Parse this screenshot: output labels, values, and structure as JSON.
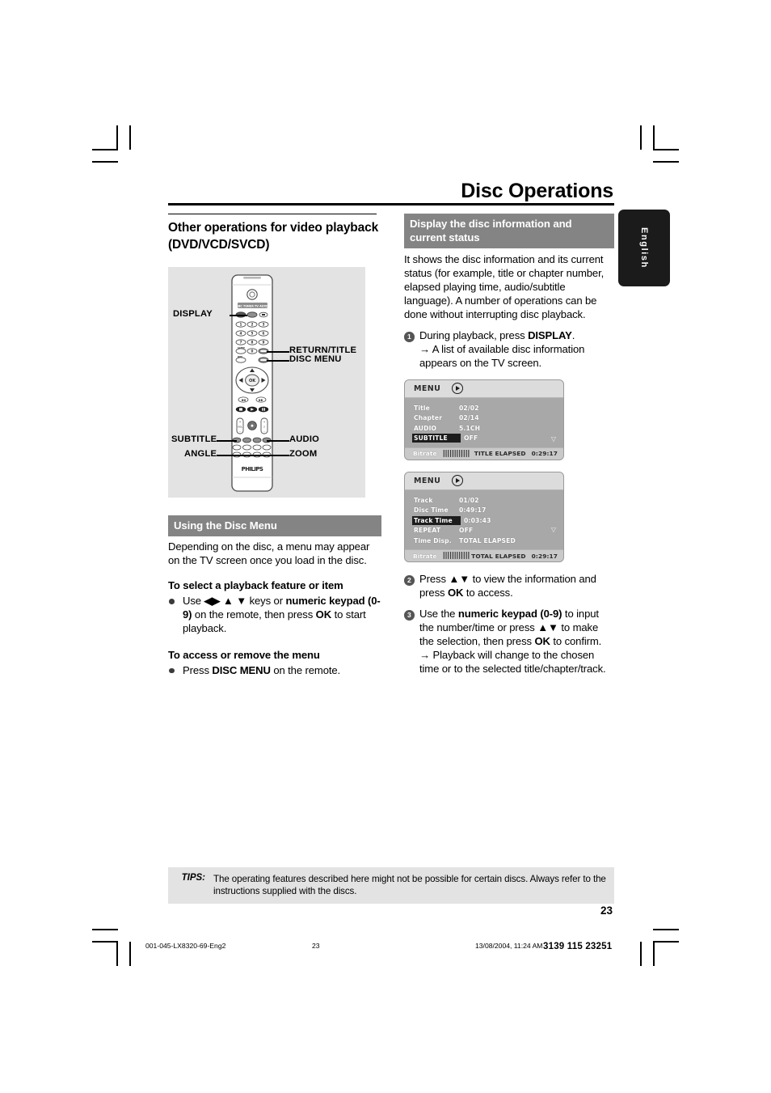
{
  "header": {
    "title": "Disc Operations",
    "language_tab": "English"
  },
  "left_column": {
    "heading": "Other operations for video playback (DVD/VCD/SVCD)",
    "remote_figure": {
      "callouts": [
        {
          "label": "DISPLAY"
        },
        {
          "label": "RETURN/TITLE"
        },
        {
          "label": "DISC MENU"
        },
        {
          "label": "SUBTITLE"
        },
        {
          "label": "AUDIO"
        },
        {
          "label": "ANGLE"
        },
        {
          "label": "ZOOM"
        }
      ],
      "brand": "PHILIPS",
      "mode_strip": "DBB TUNER TV AUXDI",
      "ok_button": "OK"
    },
    "disc_menu_section": {
      "heading": "Using the Disc Menu",
      "intro": "Depending on the disc, a menu may appear on the TV screen once you load in the disc.",
      "subhead_1": "To select a playback feature or item",
      "bullet_1": "Use ◀▶ ▲ ▼ keys or numeric keypad (0-9) on the remote, then press OK to start playback.",
      "subhead_2": "To access or remove the menu",
      "bullet_2": "Press DISC MENU on the remote."
    }
  },
  "right_column": {
    "section_heading": "Display the disc information and current status",
    "intro": "It shows the disc information and its current status (for example, title or chapter number, elapsed playing time, audio/subtitle language).  A number of operations can be done without interrupting disc playback.",
    "steps": [
      {
        "number": "1",
        "text": "During playback, press DISPLAY.",
        "result": "→ A list of available disc information appears on the TV screen."
      },
      {
        "number": "2",
        "text": "Press ▲▼ to view the information and press OK to access.",
        "result": ""
      },
      {
        "number": "3",
        "text": "Use the numeric keypad (0-9) to input the number/time or press ▲▼ to make the selection, then press OK to confirm.",
        "result": "→ Playback will change to the chosen time or to the selected title/chapter/track."
      }
    ],
    "osd_screens": [
      {
        "title": "MENU",
        "icon": "play-icon",
        "rows": [
          {
            "key": "Title",
            "value": "02/02",
            "highlighted": false
          },
          {
            "key": "Chapter",
            "value": "02/14",
            "highlighted": false
          },
          {
            "key": "AUDIO",
            "value": "5.1CH",
            "highlighted": false
          },
          {
            "key": "SUBTITLE",
            "value": "OFF",
            "highlighted": true
          }
        ],
        "scroll_caret": "▽",
        "footer": {
          "bitrate_label": "Bitrate",
          "bitrate_bars": "||||||||||||",
          "elapsed_label": "TITLE ELAPSED",
          "elapsed_time": "0:29:17"
        }
      },
      {
        "title": "MENU",
        "icon": "play-icon",
        "rows": [
          {
            "key": "Track",
            "value": "01/02",
            "highlighted": false
          },
          {
            "key": "Disc Time",
            "value": "0:49:17",
            "highlighted": false
          },
          {
            "key": "Track Time",
            "value": "0:03:43",
            "highlighted": true
          },
          {
            "key": "REPEAT",
            "value": "OFF",
            "highlighted": false
          },
          {
            "key": "Time Disp.",
            "value": "TOTAL ELAPSED",
            "highlighted": false
          }
        ],
        "scroll_caret": "▽",
        "footer": {
          "bitrate_label": "Bitrate",
          "bitrate_bars": "||||||||||||",
          "elapsed_label": "TOTAL ELAPSED",
          "elapsed_time": "0:29:17"
        }
      }
    ]
  },
  "tips": {
    "label": "TIPS:",
    "text": "The operating features described here might not be possible for certain discs.  Always refer to the instructions supplied with the discs."
  },
  "footer": {
    "page_number": "23",
    "job_name": "001-045-LX8320-69-Eng2",
    "print_page": "23",
    "print_date": "13/08/2004, 11:24 AM",
    "doc_id": "3139 115 23251"
  },
  "colors": {
    "grey_bar": "#848484",
    "tips_bg": "#e3e3e3",
    "figure_bg": "#e3e3e3",
    "tab_bg": "#1b1b1b",
    "osd_body": "#a8a8a8"
  }
}
